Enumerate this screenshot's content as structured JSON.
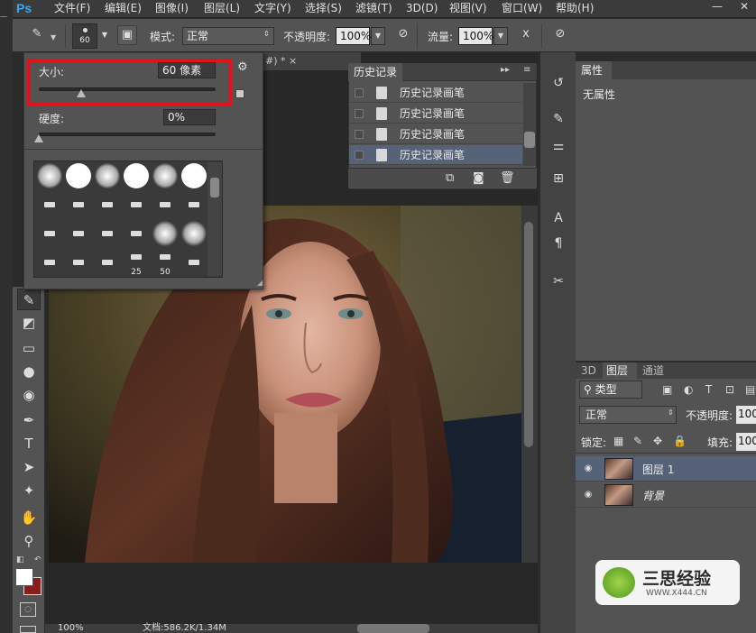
{
  "app": {
    "logo": "Ps"
  },
  "menubar": {
    "items": [
      "文件(F)",
      "编辑(E)",
      "图像(I)",
      "图层(L)",
      "文字(Y)",
      "选择(S)",
      "滤镜(T)",
      "3D(D)",
      "视图(V)",
      "窗口(W)",
      "帮助(H)"
    ],
    "minimize": "—",
    "close": "✕"
  },
  "options": {
    "brush_size": "60",
    "mode_label": "模式:",
    "mode_value": "正常",
    "opacity_label": "不透明度:",
    "opacity_value": "100%",
    "flow_label": "流量:",
    "flow_value": "100%"
  },
  "brush_popup": {
    "size_label": "大小:",
    "size_value": "60 像素",
    "size_level": 0.24,
    "hardness_label": "硬度:",
    "hardness_value": "0%",
    "hardness_level": 0.0,
    "brush_numbers": [
      "25",
      "50"
    ]
  },
  "document": {
    "tab_text": "#) *  ×",
    "status_zoom": "100%",
    "status_doc": "文档:586.2K/1.34M"
  },
  "history": {
    "tab": "历史记录",
    "items": [
      "历史记录画笔",
      "历史记录画笔",
      "历史记录画笔",
      "历史记录画笔"
    ]
  },
  "properties": {
    "tab": "属性",
    "empty": "无属性"
  },
  "layers": {
    "tabs": [
      "3D",
      "图层",
      "通道"
    ],
    "filter_label": "类型",
    "blend_mode": "正常",
    "opacity_label": "不透明度:",
    "opacity_value": "100",
    "lock_label": "锁定:",
    "fill_label": "填充:",
    "fill_value": "100",
    "items": [
      {
        "name": "图层 1"
      },
      {
        "name": "背景"
      }
    ]
  },
  "watermark": {
    "brand": "三思经验",
    "url": "WWW.X444.CN"
  },
  "colors": {
    "accent": "#31a8ff",
    "highlight_box": "#e0121a",
    "panel": "#535353",
    "selected_row": "#566277"
  }
}
